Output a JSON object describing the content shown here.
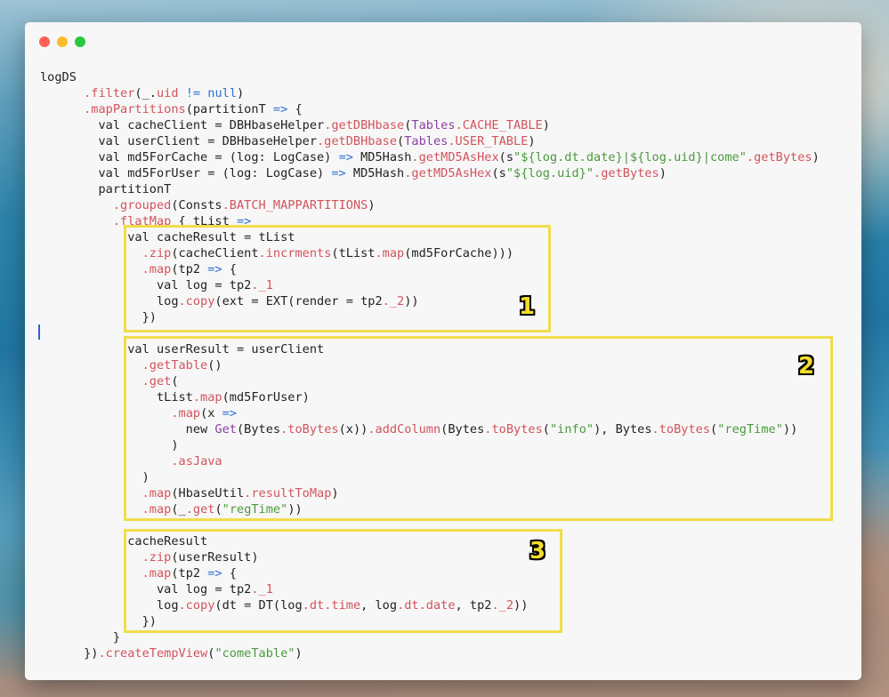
{
  "window": {
    "controls": [
      "close",
      "minimize",
      "zoom"
    ]
  },
  "code": {
    "lines": [
      [
        {
          "t": "logDS",
          "c": ""
        }
      ],
      [
        {
          "t": "      ",
          "c": ""
        },
        {
          "t": ".filter",
          "c": "method"
        },
        {
          "t": "(_.",
          "c": ""
        },
        {
          "t": "uid",
          "c": "method"
        },
        {
          "t": " ",
          "c": ""
        },
        {
          "t": "!=",
          "c": "op"
        },
        {
          "t": " ",
          "c": ""
        },
        {
          "t": "null",
          "c": "keyword"
        },
        {
          "t": ")",
          "c": ""
        }
      ],
      [
        {
          "t": "      ",
          "c": ""
        },
        {
          "t": ".mapPartitions",
          "c": "method"
        },
        {
          "t": "(partitionT ",
          "c": ""
        },
        {
          "t": "=>",
          "c": "op"
        },
        {
          "t": " {",
          "c": ""
        }
      ],
      [
        {
          "t": "        val cacheClient = DBHbaseHelper",
          "c": ""
        },
        {
          "t": ".getDBHbase",
          "c": "method"
        },
        {
          "t": "(",
          "c": ""
        },
        {
          "t": "Tables",
          "c": "type"
        },
        {
          "t": ".CACHE_TABLE",
          "c": "method"
        },
        {
          "t": ")",
          "c": ""
        }
      ],
      [
        {
          "t": "        val userClient = DBHbaseHelper",
          "c": ""
        },
        {
          "t": ".getDBHbase",
          "c": "method"
        },
        {
          "t": "(",
          "c": ""
        },
        {
          "t": "Tables",
          "c": "type"
        },
        {
          "t": ".USER_TABLE",
          "c": "method"
        },
        {
          "t": ")",
          "c": ""
        }
      ],
      [
        {
          "t": "        val md5ForCache = (log: LogCase) ",
          "c": ""
        },
        {
          "t": "=>",
          "c": "op"
        },
        {
          "t": " MD5Hash",
          "c": ""
        },
        {
          "t": ".getMD5AsHex",
          "c": "method"
        },
        {
          "t": "(s",
          "c": ""
        },
        {
          "t": "\"${log.dt.date}|${log.uid}|come\"",
          "c": "str"
        },
        {
          "t": ".getBytes",
          "c": "method"
        },
        {
          "t": ")",
          "c": ""
        }
      ],
      [
        {
          "t": "        val md5ForUser = (log: LogCase) ",
          "c": ""
        },
        {
          "t": "=>",
          "c": "op"
        },
        {
          "t": " MD5Hash",
          "c": ""
        },
        {
          "t": ".getMD5AsHex",
          "c": "method"
        },
        {
          "t": "(s",
          "c": ""
        },
        {
          "t": "\"${log.uid}\"",
          "c": "str"
        },
        {
          "t": ".getBytes",
          "c": "method"
        },
        {
          "t": ")",
          "c": ""
        }
      ],
      [
        {
          "t": "        partitionT",
          "c": ""
        }
      ],
      [
        {
          "t": "          ",
          "c": ""
        },
        {
          "t": ".grouped",
          "c": "method"
        },
        {
          "t": "(Consts",
          "c": ""
        },
        {
          "t": ".BATCH_MAPPARTITIONS",
          "c": "method"
        },
        {
          "t": ")",
          "c": ""
        }
      ],
      [
        {
          "t": "          ",
          "c": ""
        },
        {
          "t": ".flatMap",
          "c": "method"
        },
        {
          "t": " { tList ",
          "c": ""
        },
        {
          "t": "=>",
          "c": "op"
        }
      ],
      [
        {
          "t": "            val cacheResult = tList",
          "c": ""
        }
      ],
      [
        {
          "t": "              ",
          "c": ""
        },
        {
          "t": ".zip",
          "c": "method"
        },
        {
          "t": "(cacheClient",
          "c": ""
        },
        {
          "t": ".incrments",
          "c": "method"
        },
        {
          "t": "(tList",
          "c": ""
        },
        {
          "t": ".map",
          "c": "method"
        },
        {
          "t": "(md5ForCache)))",
          "c": ""
        }
      ],
      [
        {
          "t": "              ",
          "c": ""
        },
        {
          "t": ".map",
          "c": "method"
        },
        {
          "t": "(tp2 ",
          "c": ""
        },
        {
          "t": "=>",
          "c": "op"
        },
        {
          "t": " {",
          "c": ""
        }
      ],
      [
        {
          "t": "                val log = tp2",
          "c": ""
        },
        {
          "t": "._1",
          "c": "method"
        }
      ],
      [
        {
          "t": "                log",
          "c": ""
        },
        {
          "t": ".copy",
          "c": "method"
        },
        {
          "t": "(ext = EXT(render = tp2",
          "c": ""
        },
        {
          "t": "._2",
          "c": "method"
        },
        {
          "t": "))",
          "c": ""
        }
      ],
      [
        {
          "t": "              })",
          "c": ""
        }
      ],
      [
        {
          "t": "",
          "c": ""
        }
      ],
      [
        {
          "t": "            val userResult = userClient",
          "c": ""
        }
      ],
      [
        {
          "t": "              ",
          "c": ""
        },
        {
          "t": ".getTable",
          "c": "method"
        },
        {
          "t": "()",
          "c": ""
        }
      ],
      [
        {
          "t": "              ",
          "c": ""
        },
        {
          "t": ".get",
          "c": "method"
        },
        {
          "t": "(",
          "c": ""
        }
      ],
      [
        {
          "t": "                tList",
          "c": ""
        },
        {
          "t": ".map",
          "c": "method"
        },
        {
          "t": "(md5ForUser)",
          "c": ""
        }
      ],
      [
        {
          "t": "                  ",
          "c": ""
        },
        {
          "t": ".map",
          "c": "method"
        },
        {
          "t": "(x ",
          "c": ""
        },
        {
          "t": "=>",
          "c": "op"
        }
      ],
      [
        {
          "t": "                    new ",
          "c": ""
        },
        {
          "t": "Get",
          "c": "type"
        },
        {
          "t": "(Bytes",
          "c": ""
        },
        {
          "t": ".toBytes",
          "c": "method"
        },
        {
          "t": "(x))",
          "c": ""
        },
        {
          "t": ".addColumn",
          "c": "method"
        },
        {
          "t": "(Bytes",
          "c": ""
        },
        {
          "t": ".toBytes",
          "c": "method"
        },
        {
          "t": "(",
          "c": ""
        },
        {
          "t": "\"info\"",
          "c": "str"
        },
        {
          "t": "), Bytes",
          "c": ""
        },
        {
          "t": ".toBytes",
          "c": "method"
        },
        {
          "t": "(",
          "c": ""
        },
        {
          "t": "\"regTime\"",
          "c": "str"
        },
        {
          "t": "))",
          "c": ""
        }
      ],
      [
        {
          "t": "                  )",
          "c": ""
        }
      ],
      [
        {
          "t": "                  ",
          "c": ""
        },
        {
          "t": ".asJava",
          "c": "method"
        }
      ],
      [
        {
          "t": "              )",
          "c": ""
        }
      ],
      [
        {
          "t": "              ",
          "c": ""
        },
        {
          "t": ".map",
          "c": "method"
        },
        {
          "t": "(HbaseUtil",
          "c": ""
        },
        {
          "t": ".resultToMap",
          "c": "method"
        },
        {
          "t": ")",
          "c": ""
        }
      ],
      [
        {
          "t": "              ",
          "c": ""
        },
        {
          "t": ".map",
          "c": "method"
        },
        {
          "t": "(_",
          "c": ""
        },
        {
          "t": ".get",
          "c": "method"
        },
        {
          "t": "(",
          "c": ""
        },
        {
          "t": "\"regTime\"",
          "c": "str"
        },
        {
          "t": "))",
          "c": ""
        }
      ],
      [
        {
          "t": "",
          "c": ""
        }
      ],
      [
        {
          "t": "            cacheResult",
          "c": ""
        }
      ],
      [
        {
          "t": "              ",
          "c": ""
        },
        {
          "t": ".zip",
          "c": "method"
        },
        {
          "t": "(userResult)",
          "c": ""
        }
      ],
      [
        {
          "t": "              ",
          "c": ""
        },
        {
          "t": ".map",
          "c": "method"
        },
        {
          "t": "(tp2 ",
          "c": ""
        },
        {
          "t": "=>",
          "c": "op"
        },
        {
          "t": " {",
          "c": ""
        }
      ],
      [
        {
          "t": "                val log = tp2",
          "c": ""
        },
        {
          "t": "._1",
          "c": "method"
        }
      ],
      [
        {
          "t": "                log",
          "c": ""
        },
        {
          "t": ".copy",
          "c": "method"
        },
        {
          "t": "(dt = DT(log",
          "c": ""
        },
        {
          "t": ".dt",
          "c": "method"
        },
        {
          "t": ".time",
          "c": "method"
        },
        {
          "t": ", log",
          "c": ""
        },
        {
          "t": ".dt",
          "c": "method"
        },
        {
          "t": ".date",
          "c": "method"
        },
        {
          "t": ", tp2",
          "c": ""
        },
        {
          "t": "._2",
          "c": "method"
        },
        {
          "t": "))",
          "c": ""
        }
      ],
      [
        {
          "t": "              })",
          "c": ""
        }
      ],
      [
        {
          "t": "          }",
          "c": ""
        }
      ],
      [
        {
          "t": "      })",
          "c": ""
        },
        {
          "t": ".createTempView",
          "c": "method"
        },
        {
          "t": "(",
          "c": ""
        },
        {
          "t": "\"comeTable\"",
          "c": "str"
        },
        {
          "t": ")",
          "c": ""
        }
      ]
    ]
  },
  "annotations": [
    {
      "label": "1"
    },
    {
      "label": "2"
    },
    {
      "label": "3"
    }
  ],
  "colors": {
    "method": "#d2545c",
    "operator": "#2f6fd9",
    "string": "#4a9a3d",
    "type": "#8a3fa6",
    "highlight": "#f0dd4a"
  }
}
